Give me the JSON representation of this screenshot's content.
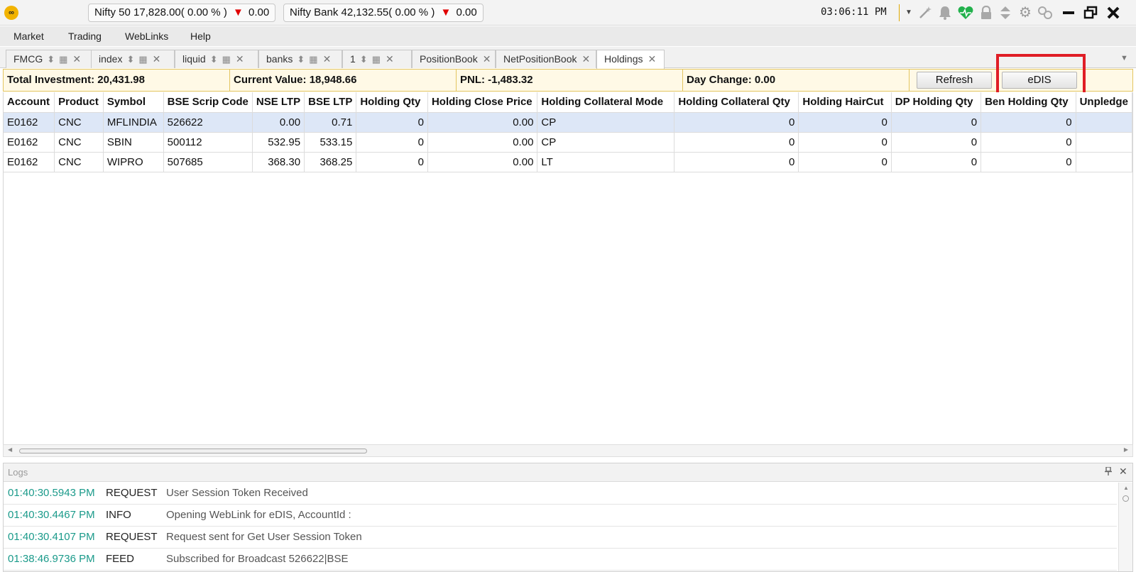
{
  "ticker": {
    "logo": "∞",
    "nifty50": {
      "name": "Nifty 50",
      "value": "17,828.00(",
      "pct": "0.00 %",
      "close": ")",
      "change": "0.00"
    },
    "niftybank": {
      "name": "Nifty Bank",
      "value": "42,132.55(",
      "pct": "0.00 %",
      "close": ")",
      "change": "0.00"
    },
    "clock": "03:06:11 PM"
  },
  "toolbar_icons": [
    "dropdown-icon",
    "magic-wand-icon",
    "bell-icon",
    "heartbeat-icon",
    "lock-icon",
    "sort-icon",
    "gear-icon",
    "link-icon",
    "minimize-icon",
    "restore-icon",
    "close-icon"
  ],
  "menu": {
    "items": [
      "Market",
      "Trading",
      "WebLinks",
      "Help"
    ]
  },
  "tabs": [
    {
      "label": "FMCG",
      "controls": true
    },
    {
      "label": "index",
      "controls": true
    },
    {
      "label": "liquid",
      "controls": true
    },
    {
      "label": "banks",
      "controls": true
    },
    {
      "label": "1",
      "controls": true
    },
    {
      "label": "PositionBook",
      "controls": false
    },
    {
      "label": "NetPositionBook",
      "controls": false
    },
    {
      "label": "Holdings",
      "controls": false,
      "active": true
    }
  ],
  "summary": {
    "total_investment": "Total Investment:  20,431.98",
    "current_value": "Current Value:  18,948.66",
    "pnl": "PNL:  -1,483.32",
    "day_change": "Day Change:  0.00",
    "refresh_label": "Refresh",
    "edis_label": "eDIS"
  },
  "holdings": {
    "columns": [
      "Account",
      "Product",
      "Symbol",
      "BSE Scrip Code",
      "NSE LTP",
      "BSE LTP",
      "Holding Qty",
      "Holding Close Price",
      "Holding Collateral Mode",
      "Holding Collateral Qty",
      "Holding HairCut",
      "DP Holding Qty",
      "Ben Holding Qty",
      "Unpledge"
    ],
    "rows": [
      [
        "E0162",
        "CNC",
        "MFLINDIA",
        "526622",
        "0.00",
        "0.71",
        "0",
        "0.00",
        "CP",
        "0",
        "0",
        "0",
        "0",
        ""
      ],
      [
        "E0162",
        "CNC",
        "SBIN",
        "500112",
        "532.95",
        "533.15",
        "0",
        "0.00",
        "CP",
        "0",
        "0",
        "0",
        "0",
        ""
      ],
      [
        "E0162",
        "CNC",
        "WIPRO",
        "507685",
        "368.30",
        "368.25",
        "0",
        "0.00",
        "LT",
        "0",
        "0",
        "0",
        "0",
        ""
      ]
    ]
  },
  "logs": {
    "title": "Logs",
    "entries": [
      {
        "time": "01:40:30.5943 PM",
        "level": "REQUEST",
        "message": "User Session Token Received"
      },
      {
        "time": "01:40:30.4467 PM",
        "level": "INFO",
        "message": "Opening WebLink for eDIS, AccountId :"
      },
      {
        "time": "01:40:30.4107 PM",
        "level": "REQUEST",
        "message": "Request sent for Get User Session Token"
      },
      {
        "time": "01:38:46.9736 PM",
        "level": "FEED",
        "message": "Subscribed for Broadcast 526622|BSE"
      }
    ]
  }
}
